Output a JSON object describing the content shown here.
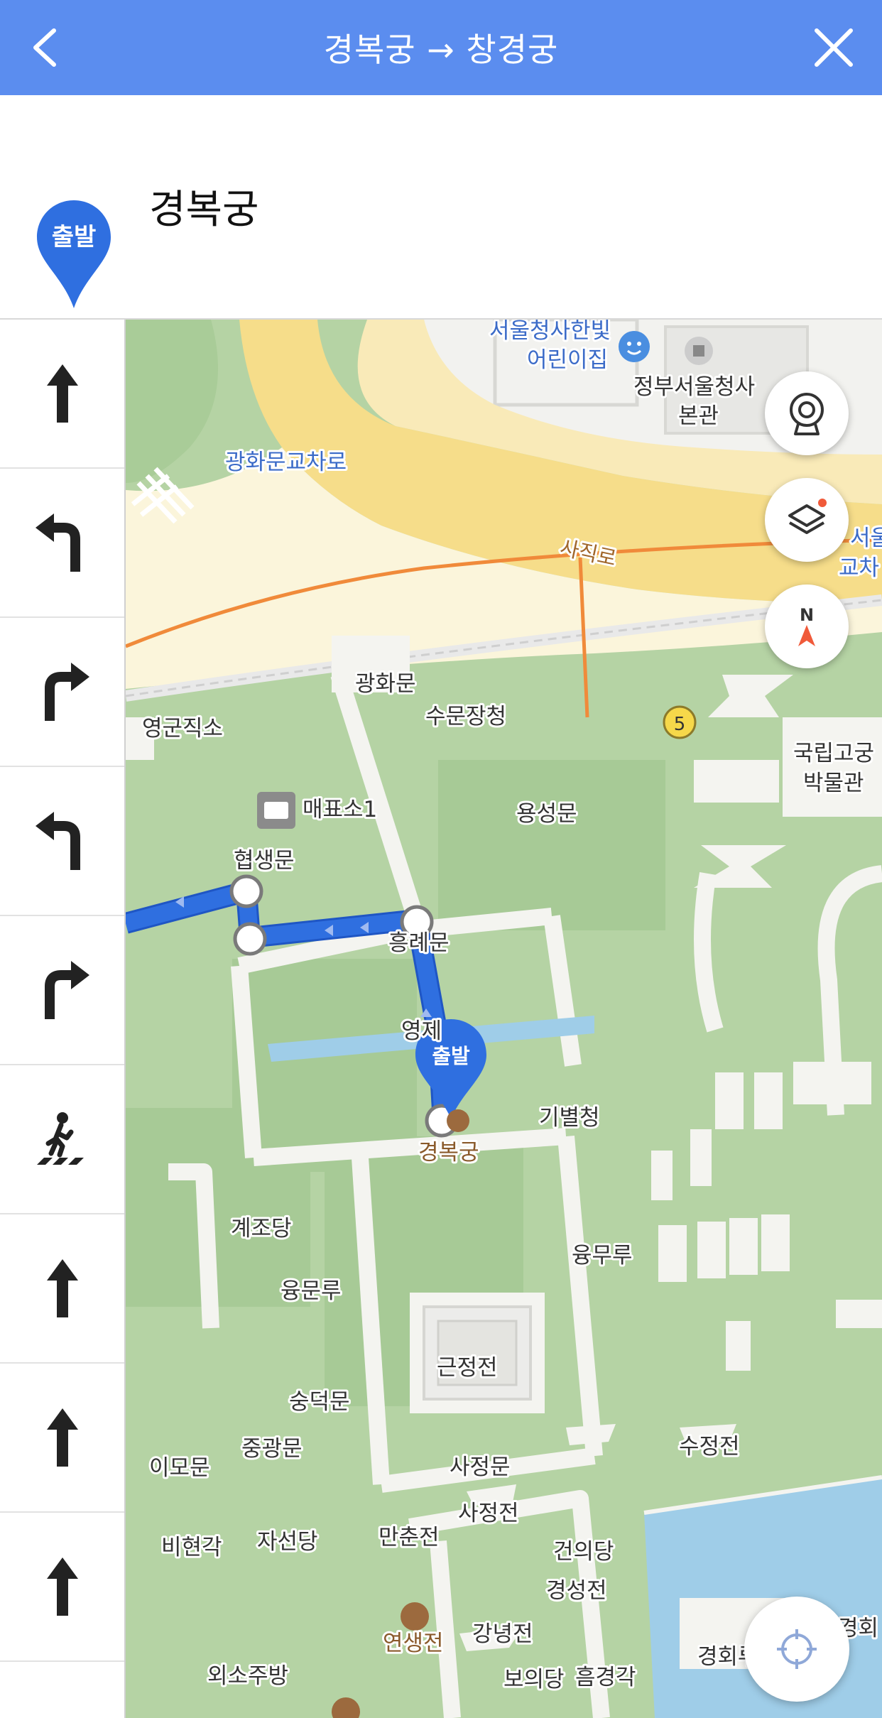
{
  "header": {
    "title": "경복궁 → 창경궁"
  },
  "origin": {
    "badge": "출발",
    "name": "경복궁"
  },
  "steps": [
    {
      "icon": "arrow-up-icon"
    },
    {
      "icon": "turn-left-icon"
    },
    {
      "icon": "turn-right-icon"
    },
    {
      "icon": "turn-left-icon"
    },
    {
      "icon": "turn-right-icon"
    },
    {
      "icon": "crosswalk-icon"
    },
    {
      "icon": "arrow-up-icon"
    },
    {
      "icon": "arrow-up-icon"
    },
    {
      "icon": "arrow-up-icon"
    }
  ],
  "map": {
    "route_color": "#2f6fe0",
    "start_marker_label": "출발",
    "bus_stop_number": "5",
    "labels": {
      "seoul_gov_daycare": "서울청사한빛",
      "seoul_gov_daycare2": "어린이집",
      "gov_complex": "정부서울청사",
      "gov_complex2": "본관",
      "gwanghwamun_intersection": "광화문교차로",
      "sajik_ro": "사직로",
      "seoul_cross": "서울",
      "seoul_cross2": "교차",
      "gwanghwamun": "광화문",
      "sumunjangcheong": "수문장청",
      "yeonggun_jikso": "영군직소",
      "ticket_office": "매표소1",
      "yongseongmun": "용성문",
      "national_palace_museum": "국립고궁",
      "national_palace_museum2": "박물관",
      "hyeopsaengmun": "협생문",
      "heungnyemun": "흥례문",
      "yeong": "영제",
      "gibyeolcheong": "기별청",
      "gyeongbokgung": "경복궁",
      "gyejodang": "계조당",
      "yungmuru": "융무루",
      "yungmunru": "융문루",
      "geunjeongjeon": "근정전",
      "sungdeokmun": "숭덕문",
      "junggwangmun": "중광문",
      "imomun": "이모문",
      "sujeongjeon": "수정전",
      "sajeongmun": "사정문",
      "sajeongjeon": "사정전",
      "bihyeongak": "비현각",
      "jaseondang": "자선당",
      "manchunjeon": "만춘전",
      "geonuigak": "건의당",
      "gyeongseongjeon": "경성전",
      "yeonsaengjeon": "연생전",
      "gangnyeongjeon": "강녕전",
      "oesojubang": "외소주방",
      "boeuidang": "보의당",
      "heumgyeonggak": "흠경각",
      "gyeonghoeru": "경회루",
      "gyeonghoeru2": "경회"
    }
  }
}
